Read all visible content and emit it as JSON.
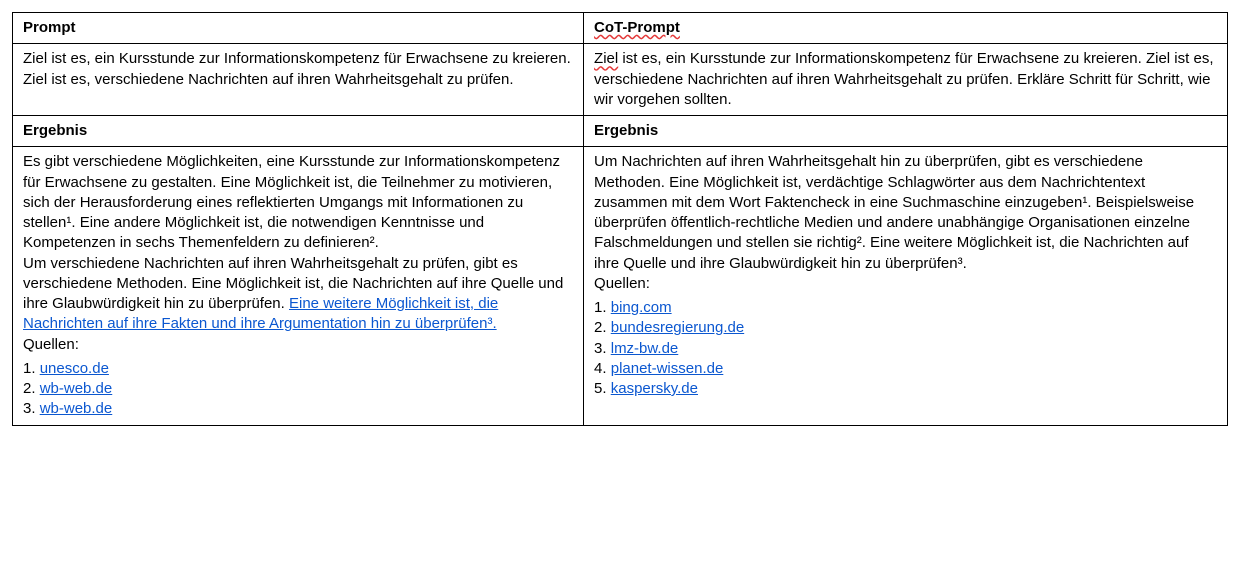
{
  "headers": {
    "prompt": "Prompt",
    "cot_prompt": "CoT-Prompt",
    "ergebnis_left": "Ergebnis",
    "ergebnis_right": "Ergebnis"
  },
  "prompt": {
    "text": "Ziel ist es, ein Kursstunde zur Informationskompetenz für Erwachsene zu kreieren. Ziel ist es, verschiedene Nachrichten auf ihren Wahrheitsgehalt zu prüfen."
  },
  "cot_prompt": {
    "squiggle": "Ziel",
    "rest": " ist es, ein Kursstunde zur Informationskompetenz für Erwachsene zu kreieren. Ziel ist es, verschiedene Nachrichten auf ihren Wahrheitsgehalt zu prüfen. Erkläre Schritt für Schritt, wie wir vorgehen sollten."
  },
  "result_left": {
    "para1": "Es gibt verschiedene Möglichkeiten, eine Kursstunde zur Informationskompetenz für Erwachsene zu gestalten. Eine Möglichkeit ist, die Teilnehmer zu motivieren, sich der Herausforderung eines reflektierten Umgangs mit Informationen zu stellen¹. Eine andere Möglichkeit ist, die notwendigen Kenntnisse und Kompetenzen in sechs Themenfeldern zu definieren².",
    "para2_plain": "Um verschiedene Nachrichten auf ihren Wahrheitsgehalt zu prüfen, gibt es verschiedene Methoden. Eine Möglichkeit ist, die Nachrichten auf ihre Quelle und ihre Glaubwürdigkeit hin zu überprüfen. ",
    "para2_link": "Eine weitere Möglichkeit ist, die Nachrichten auf ihre Fakten und ihre Argumentation hin zu überprüfen³.",
    "quellen_label": "Quellen:",
    "sources": [
      {
        "n": "1.",
        "href": "#",
        "text": "unesco.de"
      },
      {
        "n": "2.",
        "href": "#",
        "text": "wb-web.de"
      },
      {
        "n": "3.",
        "href": "#",
        "text": "wb-web.de"
      }
    ]
  },
  "result_right": {
    "para1": "Um Nachrichten auf ihren Wahrheitsgehalt hin zu überprüfen, gibt es verschiedene Methoden. Eine Möglichkeit ist, verdächtige Schlagwörter aus dem Nachrichtentext zusammen mit dem Wort Faktencheck in eine Suchmaschine einzugeben¹. Beispielsweise überprüfen öffentlich-rechtliche Medien und andere unabhängige Organisationen einzelne Falschmeldungen und stellen sie richtig². Eine weitere Möglichkeit ist, die Nachrichten auf ihre Quelle und ihre Glaubwürdigkeit hin zu überprüfen³.",
    "quellen_label": "Quellen:",
    "sources": [
      {
        "n": "1.",
        "href": "#",
        "text": "bing.com"
      },
      {
        "n": "2.",
        "href": "#",
        "text": "bundesregierung.de"
      },
      {
        "n": "3.",
        "href": "#",
        "text": "lmz-bw.de"
      },
      {
        "n": "4.",
        "href": "#",
        "text": "planet-wissen.de"
      },
      {
        "n": "5.",
        "href": "#",
        "text": "kaspersky.de"
      }
    ]
  }
}
